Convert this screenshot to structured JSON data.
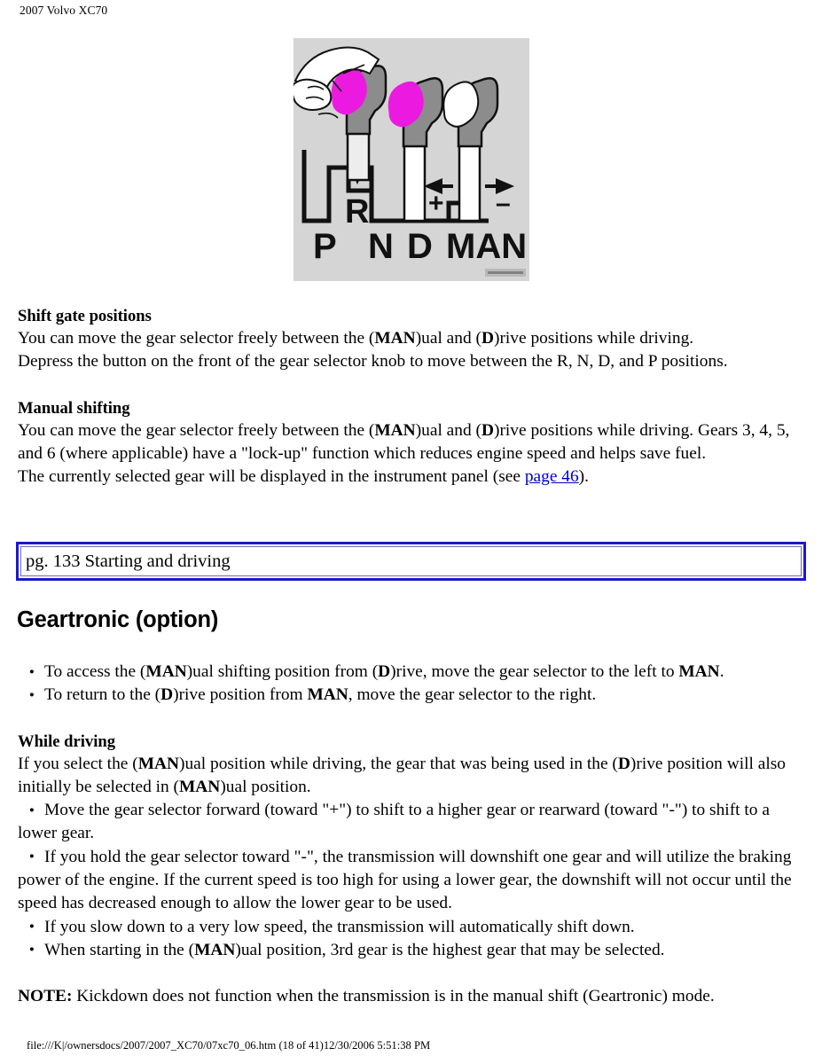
{
  "header": {
    "running_title": "2007 Volvo XC70"
  },
  "figure": {
    "alt_name": "gear-shift-gate-illustration",
    "background_color": "#d5d5d5",
    "knob_highlight_color": "#ec1ae0",
    "knob_body_color": "#8c8c8c",
    "gate_positions": [
      "P",
      "R",
      "N",
      "D",
      "MAN"
    ],
    "labels_row": [
      "P",
      "N",
      "D",
      "MAN"
    ],
    "reverse_label": "R",
    "manual_plus": "+",
    "manual_minus": "–"
  },
  "sections": [
    {
      "heading": "Shift gate positions",
      "paragraphs": [
        "You can move the gear selector freely between the (MAN)ual and (D)rive positions while driving.",
        "Depress the button on the front of the gear selector knob to move between the R, N, D, and P positions."
      ]
    },
    {
      "heading": "Manual shifting",
      "paragraphs": [
        "You can move the gear selector freely between the (MAN)ual and (D)rive positions while driving. Gears 3, 4, 5, and 6 (where applicable) have a \"lock-up\" function which reduces engine speed and helps save fuel.",
        "The currently selected gear will be displayed in the instrument panel (see page 46)."
      ],
      "link_text": "page 46",
      "link_color": "#0000cc"
    }
  ],
  "shift_gate": {
    "heading": "Shift gate positions",
    "line1_a": "You can move the gear selector freely between the (",
    "line1_man": "MAN",
    "line1_b": ")ual and (",
    "line1_d": "D",
    "line1_c": ")rive positions while driving.",
    "line2": "Depress the button on the front of the gear selector knob to move between the R, N, D, and P positions."
  },
  "manual_shifting": {
    "heading": "Manual shifting",
    "p1_a": "You can move the gear selector freely between the (",
    "p1_man": "MAN",
    "p1_b": ")ual and (",
    "p1_d": "D",
    "p1_c": ")rive positions while driving. Gears 3, 4, 5, and 6 (where applicable) have a \"lock-up\" function which reduces engine speed and helps save fuel.",
    "p2_a": "The currently selected gear will be displayed in the instrument panel (see ",
    "p2_link": "page 46",
    "p2_b": ")."
  },
  "nav_banner": {
    "label": "pg. 133 Starting and driving",
    "border_color": "#1a1aca",
    "inner_border_color": "#6e6eb4"
  },
  "geartronic": {
    "title": "Geartronic (option)",
    "bullets": [
      {
        "a": "To access the (",
        "b1": "MAN",
        "c": ")ual shifting position from (",
        "b2": "D",
        "d": ")rive, move the gear selector to the left to ",
        "b3": "MAN",
        "e": "."
      },
      {
        "a": "To return to the (",
        "b1": "D",
        "c": ")rive position from ",
        "b2": "MAN",
        "d": ", move the gear selector to the right."
      }
    ]
  },
  "while_driving": {
    "heading": "While driving",
    "intro_a": "If you select the (",
    "intro_man": "MAN",
    "intro_b": ")ual position while driving, the gear that was being used in the (",
    "intro_d": "D",
    "intro_c": ")rive position will also initially be selected in (",
    "intro_man2": "MAN",
    "intro_e": ")ual position.",
    "bullets": [
      "Move the gear selector forward (toward \"+\") to shift to a higher gear or rearward (toward \"-\") to shift to a lower gear.",
      "If you hold the gear selector toward \"-\", the transmission will downshift one gear and will utilize the braking power of the engine. If the current speed is too high for using a lower gear, the downshift will not occur until the speed has decreased enough to allow the lower gear to be used.",
      "If you slow down to a very low speed, the transmission will automatically shift down."
    ],
    "bullet_last_a": "When starting in the (",
    "bullet_last_man": "MAN",
    "bullet_last_b": ")ual position, 3rd gear is the highest gear that may be selected."
  },
  "note": {
    "label": "NOTE:",
    "text": " Kickdown does not function when the transmission is in the manual shift (Geartronic) mode."
  },
  "footer": {
    "path_and_timestamp": "file:///K|/ownersdocs/2007/2007_XC70/07xc70_06.htm (18 of 41)12/30/2006 5:51:38 PM"
  }
}
